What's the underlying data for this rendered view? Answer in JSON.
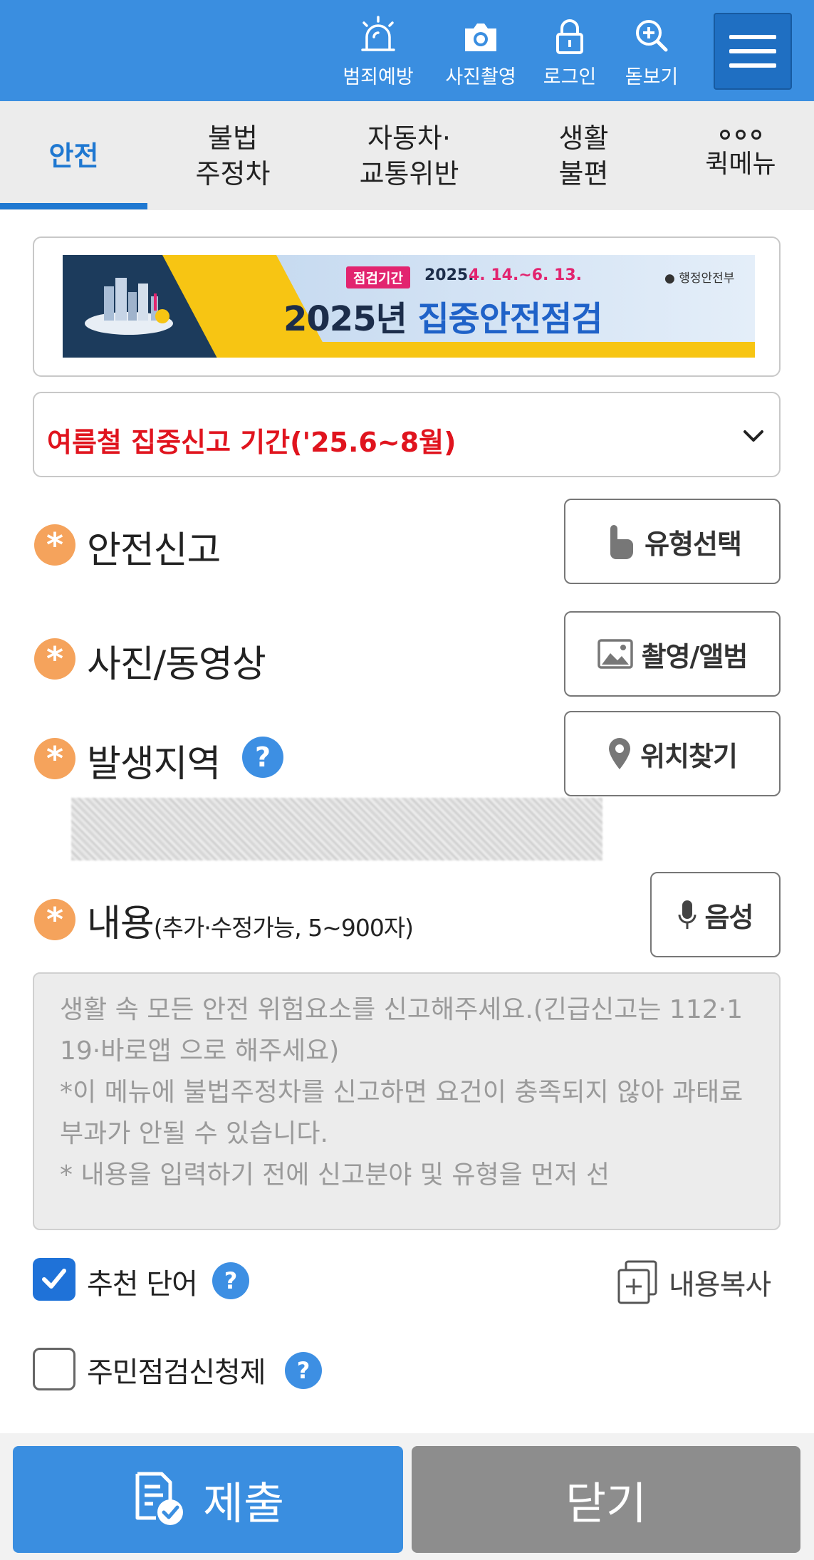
{
  "header": {
    "icons": [
      {
        "label": "범죄예방",
        "icon": "siren-icon"
      },
      {
        "label": "사진촬영",
        "icon": "camera-icon"
      },
      {
        "label": "로그인",
        "icon": "lock-icon"
      },
      {
        "label": "돋보기",
        "icon": "magnifier-plus-icon"
      }
    ],
    "menu_icon": "hamburger-menu-icon",
    "color": "#3a8ee0"
  },
  "tabs": [
    {
      "line1": "안전",
      "line2": "",
      "active": true
    },
    {
      "line1": "불법",
      "line2": "주정차",
      "active": false
    },
    {
      "line1": "자동차·",
      "line2": "교통위반",
      "active": false
    },
    {
      "line1": "생활",
      "line2": "불편",
      "active": false
    },
    {
      "line1": "퀵메뉴",
      "line2": "",
      "active": false,
      "icon": "more-dots-icon"
    }
  ],
  "banner": {
    "period_tag": "점검기간",
    "period_year": "2025.",
    "period_dates": "4. 14.~6. 13.",
    "ministry": "행정안전부",
    "title_prefix": "2025년",
    "title_main": "집중안전점검"
  },
  "notice_dropdown": {
    "text": "여름철 집중신고 기간('25.6~8월)",
    "color": "#e0141e"
  },
  "form": {
    "required_mark": "*",
    "safety_report": {
      "label": "안전신고",
      "button": "유형선택",
      "button_icon": "touch-hand-icon"
    },
    "media": {
      "label": "사진/동영상",
      "button": "촬영/앨범",
      "button_icon": "image-icon"
    },
    "location": {
      "label": "발생지역",
      "help": "?",
      "button": "위치찾기",
      "button_icon": "location-pin-icon"
    },
    "content": {
      "label": "내용",
      "hint": "(추가·수정가능, 5~900자)",
      "button": "음성",
      "button_icon": "microphone-icon",
      "placeholder": "생활 속 모든 안전 위험요소를 신고해주세요.(긴급신고는 112·119·바로앱 으로 해주세요)\n*이 메뉴에 불법주정차를 신고하면 요건이 충족되지 않아 과태료 부과가 안될 수 있습니다.\n* 내용을 입력하기 전에 신고분야 및 유형을 먼저 선"
    },
    "recommend_words": {
      "label": "추천 단어",
      "checked": true,
      "help": "?"
    },
    "copy_content": {
      "label": "내용복사",
      "icon": "copy-plus-icon"
    },
    "resident_inspection": {
      "label": "주민점검신청제",
      "checked": false,
      "help": "?"
    }
  },
  "footer": {
    "submit": {
      "label": "제출",
      "icon": "document-check-icon"
    },
    "close": {
      "label": "닫기"
    }
  }
}
